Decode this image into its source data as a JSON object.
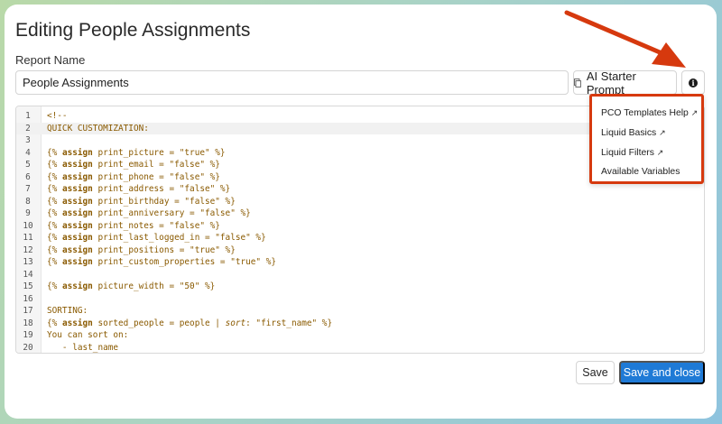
{
  "page": {
    "title": "Editing People Assignments",
    "report_name_label": "Report Name",
    "report_name_value": "People Assignments"
  },
  "toolbar": {
    "starter_label": "AI Starter Prompt",
    "info_glyph": "i"
  },
  "help_menu": {
    "items": [
      {
        "label": "PCO Templates Help",
        "external": "↗"
      },
      {
        "label": "Liquid Basics",
        "external": "↗"
      },
      {
        "label": "Liquid Filters",
        "external": "↗"
      },
      {
        "label": "Available Variables",
        "external": ""
      }
    ]
  },
  "editor": {
    "lines": [
      {
        "n": "1",
        "text": "<!--"
      },
      {
        "n": "2",
        "text": "QUICK CUSTOMIZATION:"
      },
      {
        "n": "3",
        "text": ""
      },
      {
        "n": "4",
        "pre": "{% ",
        "kw": "assign",
        "post": " print_picture = \"true\" %}"
      },
      {
        "n": "5",
        "pre": "{% ",
        "kw": "assign",
        "post": " print_email = \"false\" %}"
      },
      {
        "n": "6",
        "pre": "{% ",
        "kw": "assign",
        "post": " print_phone = \"false\" %}"
      },
      {
        "n": "7",
        "pre": "{% ",
        "kw": "assign",
        "post": " print_address = \"false\" %}"
      },
      {
        "n": "8",
        "pre": "{% ",
        "kw": "assign",
        "post": " print_birthday = \"false\" %}"
      },
      {
        "n": "9",
        "pre": "{% ",
        "kw": "assign",
        "post": " print_anniversary = \"false\" %}"
      },
      {
        "n": "10",
        "pre": "{% ",
        "kw": "assign",
        "post": " print_notes = \"false\" %}"
      },
      {
        "n": "11",
        "pre": "{% ",
        "kw": "assign",
        "post": " print_last_logged_in = \"false\" %}"
      },
      {
        "n": "12",
        "pre": "{% ",
        "kw": "assign",
        "post": " print_positions = \"true\" %}"
      },
      {
        "n": "13",
        "pre": "{% ",
        "kw": "assign",
        "post": " print_custom_properties = \"true\" %}"
      },
      {
        "n": "14",
        "text": ""
      },
      {
        "n": "15",
        "pre": "{% ",
        "kw": "assign",
        "post": " picture_width = \"50\" %}"
      },
      {
        "n": "16",
        "text": ""
      },
      {
        "n": "17",
        "text": "SORTING:"
      },
      {
        "n": "18",
        "pre": "{% ",
        "kw": "assign",
        "post": " sorted_people = people | ",
        "em": "sort",
        "tail": ": \"first_name\" %}"
      },
      {
        "n": "19",
        "text": "You can sort on:"
      },
      {
        "n": "20",
        "text": "   - last_name"
      }
    ]
  },
  "footer": {
    "save_label": "Save",
    "save_close_label": "Save and close"
  },
  "colors": {
    "primary": "#1f7ad6",
    "annotation": "#d6390e",
    "code": "#8a5a00"
  }
}
